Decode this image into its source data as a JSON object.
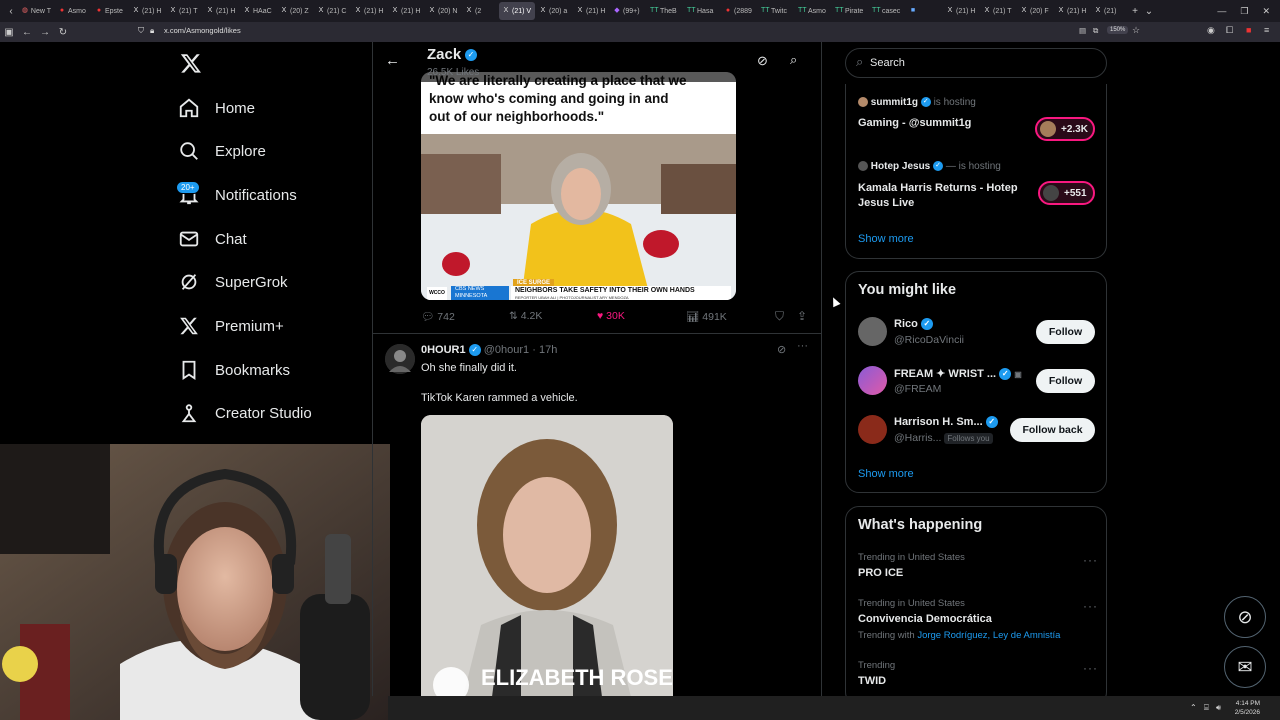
{
  "browser": {
    "tabs": [
      {
        "icon": "firefox",
        "label": "New T"
      },
      {
        "icon": "red",
        "label": "Asmo"
      },
      {
        "icon": "red",
        "label": "Epste"
      },
      {
        "icon": "x",
        "label": "(21) H"
      },
      {
        "icon": "x",
        "label": "(21) T"
      },
      {
        "icon": "x",
        "label": "(21) H"
      },
      {
        "icon": "x",
        "label": "HAaC"
      },
      {
        "icon": "x",
        "label": "(20) Z"
      },
      {
        "icon": "x",
        "label": "(21) C"
      },
      {
        "icon": "x",
        "label": "(21) H"
      },
      {
        "icon": "x",
        "label": "(21) H"
      },
      {
        "icon": "x",
        "label": "(20) N"
      },
      {
        "icon": "x",
        "label": "(2"
      },
      {
        "icon": "x",
        "label": "(21) V"
      },
      {
        "icon": "x",
        "label": "(20) a"
      },
      {
        "icon": "x",
        "label": "(21) H"
      },
      {
        "icon": "purple",
        "label": "(99+)"
      },
      {
        "icon": "tt",
        "label": "TheB"
      },
      {
        "icon": "tt",
        "label": "Hasa"
      },
      {
        "icon": "red",
        "label": "(2889"
      },
      {
        "icon": "tt",
        "label": "Twitc"
      },
      {
        "icon": "tt",
        "label": "Asmo"
      },
      {
        "icon": "tt",
        "label": "Pirate"
      },
      {
        "icon": "tt",
        "label": "casec"
      },
      {
        "icon": "blue",
        "label": ""
      },
      {
        "icon": "x",
        "label": "(21) H"
      },
      {
        "icon": "x",
        "label": "(21) T"
      },
      {
        "icon": "x",
        "label": "(20) F"
      },
      {
        "icon": "x",
        "label": "(21) H"
      },
      {
        "icon": "x",
        "label": "(21) "
      }
    ],
    "url": "x.com/Asmongold/likes",
    "zoom": "150%"
  },
  "nav": {
    "items": [
      {
        "label": "Home",
        "icon": "home-icon"
      },
      {
        "label": "Explore",
        "icon": "search-icon"
      },
      {
        "label": "Notifications",
        "icon": "bell-icon",
        "badge": "20+"
      },
      {
        "label": "Chat",
        "icon": "mail-icon"
      },
      {
        "label": "SuperGrok",
        "icon": "grok-icon"
      },
      {
        "label": "Premium+",
        "icon": "x-logo-icon"
      },
      {
        "label": "Bookmarks",
        "icon": "bookmark-icon"
      },
      {
        "label": "Creator Studio",
        "icon": "flask-icon"
      }
    ]
  },
  "header": {
    "name": "Zack",
    "likes": "26.5K Likes"
  },
  "tweet1": {
    "quote_line1": "\"We are literally creating a place that we",
    "quote_line2": "know who's coming and going in and",
    "quote_line3": "out of our neighborhoods.\"",
    "chyron_tag": "ICE SURGE",
    "chyron_network": "CBS NEWS",
    "chyron_network_sub": "MINNESOTA",
    "chyron_headline": "NEIGHBORS TAKE SAFETY INTO THEIR OWN HANDS",
    "chyron_credit": "REPORTER UBAH ALI | PHOTOJOURNALIST ARY MENDOZA",
    "station": "WCCO",
    "replies": "742",
    "reposts": "4.2K",
    "likes": "30K",
    "views": "491K"
  },
  "tweet2": {
    "name": "0HOUR1",
    "handle": "@0hour1",
    "time": "· 17h",
    "text1": "Oh she finally did it.",
    "text2": "TikTok Karen rammed a vehicle.",
    "image_caption": "ELIZABETH ROSE"
  },
  "right": {
    "search_placeholder": "Search",
    "spaces": [
      {
        "host": "summit1g",
        "status": "is hosting",
        "title": "Gaming - @summit1g",
        "count": "+2.3K"
      },
      {
        "host": "Hotep Jesus",
        "extra": "—",
        "status": "is hosting",
        "title": "Kamala Harris Returns - Hotep Jesus Live",
        "count": "+551"
      }
    ],
    "show_more": "Show more",
    "might_like_title": "You might like",
    "suggestions": [
      {
        "name": "Rico",
        "handle": "@RicoDaVincii",
        "button": "Follow"
      },
      {
        "name": "FREAM ✦ WRIST ...",
        "handle": "@FREAM",
        "button": "Follow"
      },
      {
        "name": "Harrison H. Sm...",
        "handle": "@Harris...",
        "follows_you": "Follows you",
        "button": "Follow back"
      }
    ],
    "show_more2": "Show more",
    "happening_title": "What's happening",
    "trends": [
      {
        "context": "Trending in United States",
        "topic": "PRO ICE"
      },
      {
        "context": "Trending in United States",
        "topic": "Convivencia Democrática",
        "with_label": "Trending with",
        "with_links": "Jorge Rodríguez, Ley de Amnistía"
      },
      {
        "context": "Trending",
        "topic": "TWID"
      }
    ]
  },
  "taskbar": {
    "time": "4:14 PM",
    "date": "2/5/2026"
  },
  "colors": {
    "accent": "#1d9bf0",
    "like": "#f91880",
    "bg": "#000000",
    "border": "#2f3336"
  }
}
